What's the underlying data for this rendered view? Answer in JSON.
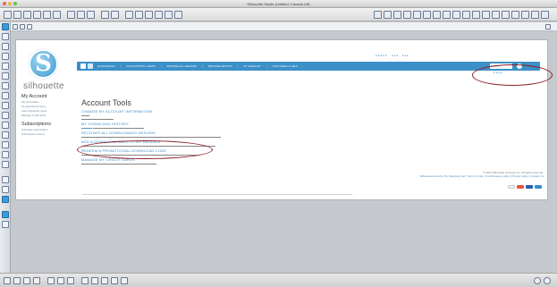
{
  "window": {
    "title": "Silhouette Studio (Untitled: Canada Lift)"
  },
  "topbar": {
    "menu": [
      "HOW DESIGN",
      "FOR EXISTING USERS",
      "BROWSE ALL DESIGNS",
      "BROWSE ARTISTS",
      "MY WISHLIST",
      "CUSTOMER & HELP"
    ],
    "search_placeholder": "Search"
  },
  "brand": {
    "wordmark": "silhouette"
  },
  "sidebar": {
    "my_account": {
      "title": "My Account",
      "links": [
        "My Information",
        "My download history",
        "View download cards",
        "Manage credit cards"
      ]
    },
    "subscriptions": {
      "title": "Subscriptions",
      "links": [
        "Purchase subscription",
        "Subscription history"
      ]
    }
  },
  "content": {
    "title": "Account Tools",
    "sections": [
      {
        "head": "CHANGE MY ACCOUNT INFORMATION"
      },
      {
        "head": "MY DOWNLOAD HISTORY"
      },
      {
        "head": "RECOVER ALL DOWNLOADED DESIGNS"
      },
      {
        "head": "ADD A DOWNLOAD CARD TO MY BALANCE"
      },
      {
        "head": "REDEEM A PROMOTIONAL DOWNLOAD CODE"
      },
      {
        "head": "MANAGE MY CREDIT CARDS"
      }
    ]
  },
  "footer": {
    "line1": "© 2012 Silhouette America, Inc. All rights reserved.",
    "line2": "Silhouette America | My Shopping Cart | Terms of Use | Conformance policy | Privacy policy | Contact Us"
  },
  "colors": {
    "accent": "#3c8fc7",
    "highlight_ring": "#8a1b22"
  }
}
